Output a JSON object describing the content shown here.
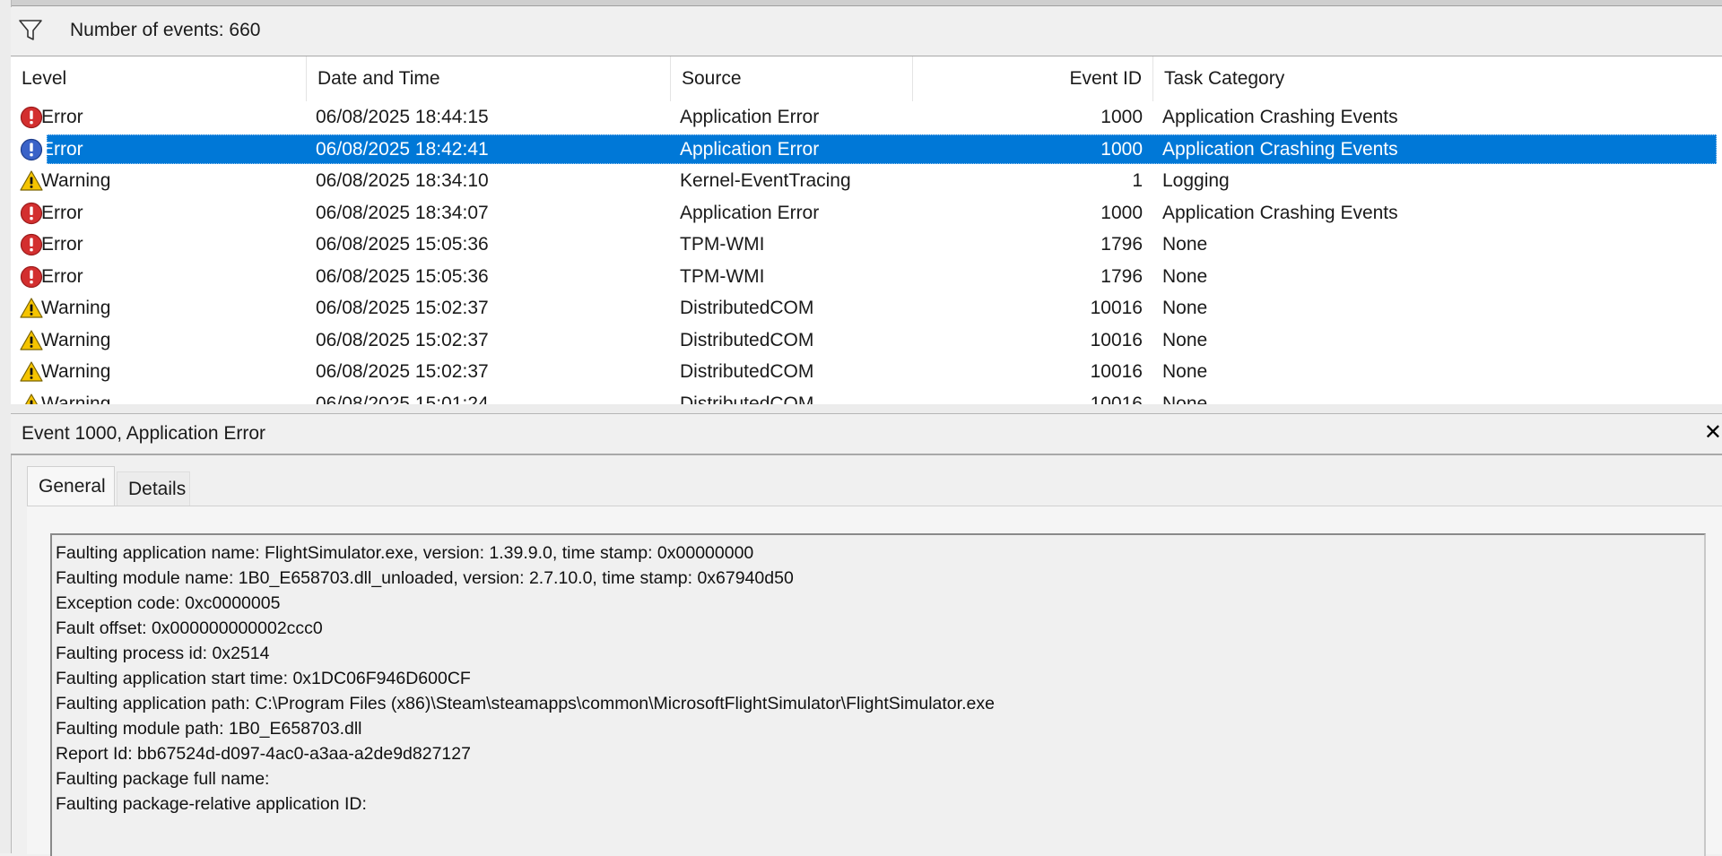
{
  "filter": {
    "icon": "funnel-filter-icon",
    "text": "Number of events: 660"
  },
  "columns": {
    "level": "Level",
    "datetime": "Date and Time",
    "source": "Source",
    "event_id": "Event ID",
    "task_category": "Task Category"
  },
  "events": [
    {
      "level": "Error",
      "icon": "error-icon",
      "datetime": "06/08/2025 18:44:15",
      "source": "Application Error",
      "event_id": "1000",
      "task_category": "Application Crashing Events",
      "selected": false
    },
    {
      "level": "Error",
      "icon": "error-icon",
      "datetime": "06/08/2025 18:42:41",
      "source": "Application Error",
      "event_id": "1000",
      "task_category": "Application Crashing Events",
      "selected": true
    },
    {
      "level": "Warning",
      "icon": "warning-icon",
      "datetime": "06/08/2025 18:34:10",
      "source": "Kernel-EventTracing",
      "event_id": "1",
      "task_category": "Logging",
      "selected": false
    },
    {
      "level": "Error",
      "icon": "error-icon",
      "datetime": "06/08/2025 18:34:07",
      "source": "Application Error",
      "event_id": "1000",
      "task_category": "Application Crashing Events",
      "selected": false
    },
    {
      "level": "Error",
      "icon": "error-icon",
      "datetime": "06/08/2025 15:05:36",
      "source": "TPM-WMI",
      "event_id": "1796",
      "task_category": "None",
      "selected": false
    },
    {
      "level": "Error",
      "icon": "error-icon",
      "datetime": "06/08/2025 15:05:36",
      "source": "TPM-WMI",
      "event_id": "1796",
      "task_category": "None",
      "selected": false
    },
    {
      "level": "Warning",
      "icon": "warning-icon",
      "datetime": "06/08/2025 15:02:37",
      "source": "DistributedCOM",
      "event_id": "10016",
      "task_category": "None",
      "selected": false
    },
    {
      "level": "Warning",
      "icon": "warning-icon",
      "datetime": "06/08/2025 15:02:37",
      "source": "DistributedCOM",
      "event_id": "10016",
      "task_category": "None",
      "selected": false
    },
    {
      "level": "Warning",
      "icon": "warning-icon",
      "datetime": "06/08/2025 15:02:37",
      "source": "DistributedCOM",
      "event_id": "10016",
      "task_category": "None",
      "selected": false
    },
    {
      "level": "Warning",
      "icon": "warning-icon",
      "datetime": "06/08/2025 15:01:24",
      "source": "DistributedCOM",
      "event_id": "10016",
      "task_category": "None",
      "selected": false
    }
  ],
  "detail": {
    "title": "Event 1000, Application Error",
    "close_glyph": "✕",
    "tabs": [
      {
        "label": "General",
        "active": true
      },
      {
        "label": "Details",
        "active": false
      }
    ],
    "description_lines": [
      "Faulting application name: FlightSimulator.exe, version: 1.39.9.0, time stamp: 0x00000000",
      "Faulting module name: 1B0_E658703.dll_unloaded, version: 2.7.10.0, time stamp: 0x67940d50",
      "Exception code: 0xc0000005",
      "Fault offset: 0x000000000002ccc0",
      "Faulting process id: 0x2514",
      "Faulting application start time: 0x1DC06F946D600CF",
      "Faulting application path: C:\\Program Files (x86)\\Steam\\steamapps\\common\\MicrosoftFlightSimulator\\FlightSimulator.exe",
      "Faulting module path: 1B0_E658703.dll",
      "Report Id: bb67524d-d097-4ac0-a3aa-a2de9d827127",
      "Faulting package full name:",
      "Faulting package-relative application ID:"
    ]
  },
  "colors": {
    "selection": "#0078d7",
    "error_red": "#d32f2f",
    "warning_yellow": "#f5c400"
  }
}
